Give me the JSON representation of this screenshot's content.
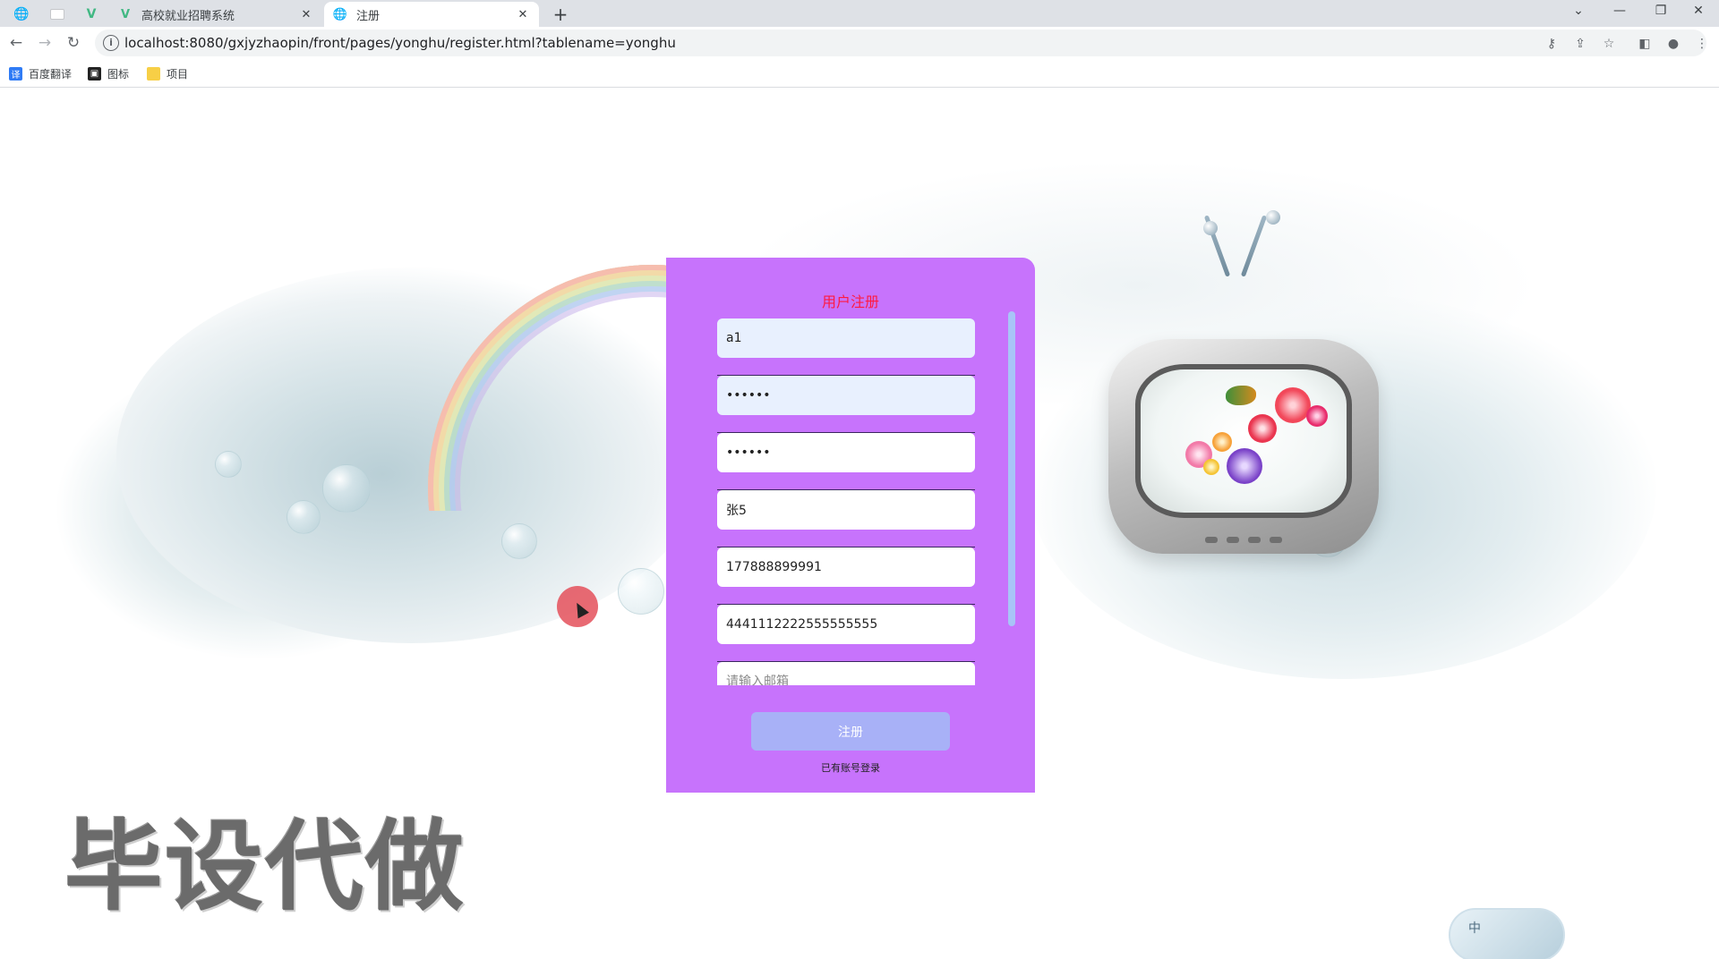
{
  "browser": {
    "tabs": [
      {
        "title": "高校就业招聘系统",
        "close": "✕"
      },
      {
        "title": "注册",
        "close": "✕"
      }
    ],
    "new_tab": "+",
    "url": "localhost:8080/gxjyzhaopin/front/pages/yonghu/register.html?tablename=yonghu",
    "bookmarks": [
      {
        "label": "百度翻译",
        "icon": "translate-icon"
      },
      {
        "label": "图标",
        "icon": "image-icon"
      },
      {
        "label": "项目",
        "icon": "folder-icon"
      }
    ]
  },
  "register": {
    "title": "用户注册",
    "fields": [
      {
        "name": "account",
        "value": "a1",
        "placeholder": "",
        "type": "text"
      },
      {
        "name": "password",
        "value": "aaaaaa",
        "placeholder": "",
        "type": "password"
      },
      {
        "name": "confirm-password",
        "value": "aaaaaa",
        "placeholder": "",
        "type": "password"
      },
      {
        "name": "real-name",
        "value": "张5",
        "placeholder": "",
        "type": "text"
      },
      {
        "name": "phone",
        "value": "177888899991",
        "placeholder": "",
        "type": "text"
      },
      {
        "name": "id-card",
        "value": "4441112222555555555",
        "placeholder": "",
        "type": "text"
      },
      {
        "name": "email",
        "value": "",
        "placeholder": "请输入邮箱",
        "type": "text"
      }
    ],
    "submit_label": "注册",
    "login_link": "已有账号登录"
  },
  "watermark": "毕设代做",
  "ime_label": "中",
  "colors": {
    "panel": "#c773fc",
    "title": "#ff1a40",
    "submit": "#a8b1f7",
    "autofill": "#e8f0fe"
  }
}
